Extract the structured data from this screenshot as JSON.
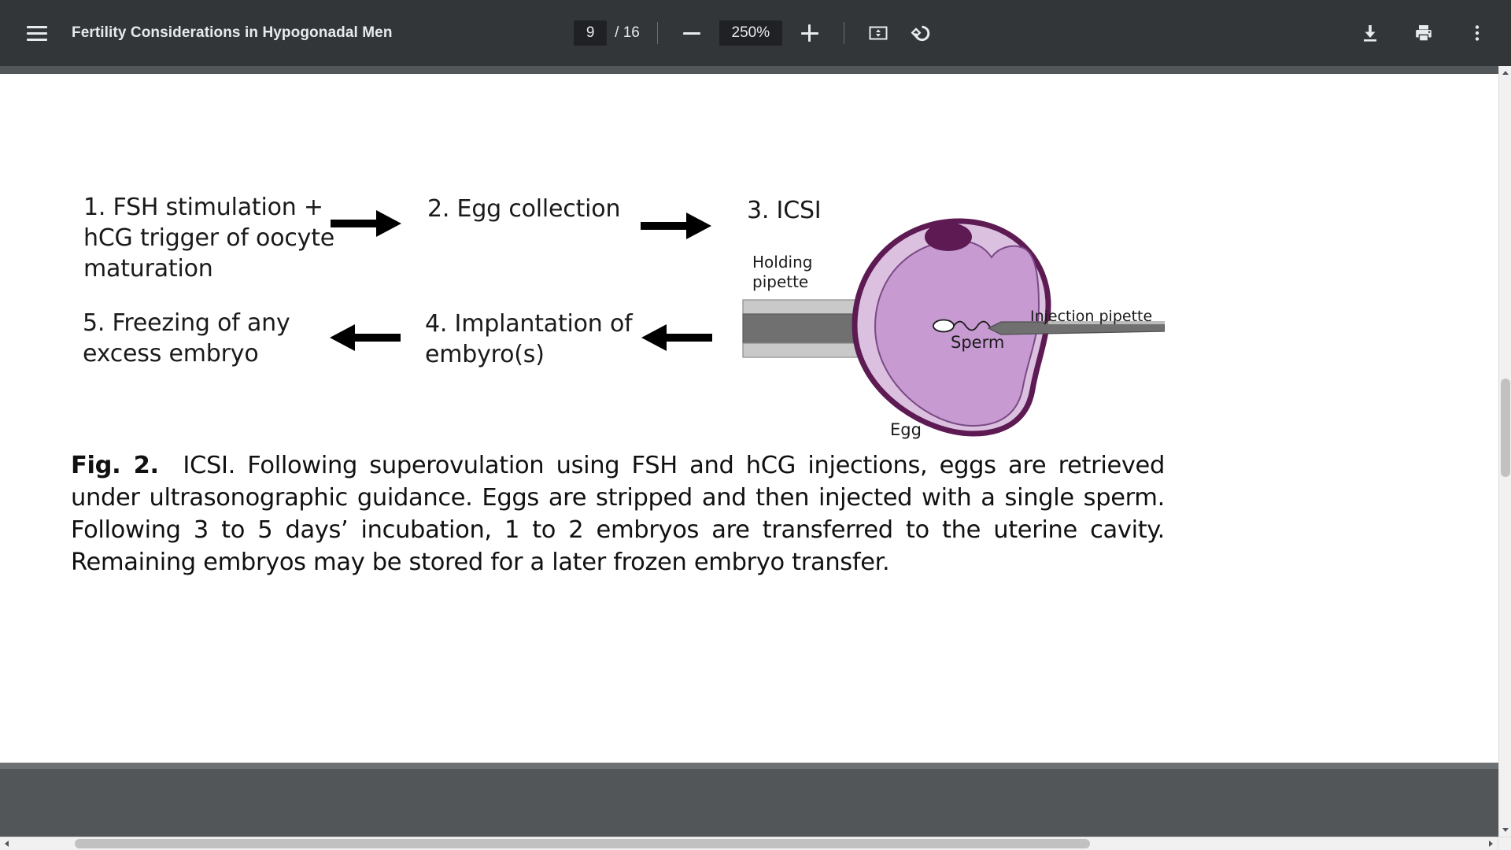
{
  "toolbar": {
    "menu_icon": "hamburger-menu-icon",
    "title": "Fertility Considerations in Hypogonadal Men",
    "page_current": "9",
    "page_total": "/ 16",
    "zoom_out_icon": "minus-icon",
    "zoom_level": "250%",
    "zoom_in_icon": "plus-icon",
    "fit_icon": "fit-to-page-icon",
    "rotate_icon": "rotate-counterclockwise-icon",
    "download_icon": "download-icon",
    "print_icon": "print-icon",
    "more_icon": "more-options-kebab-icon"
  },
  "figure": {
    "steps": [
      {
        "id": "step1",
        "text": "1. FSH stimulation +\nhCG trigger of oocyte\nmaturation"
      },
      {
        "id": "step2",
        "text": "2. Egg collection"
      },
      {
        "id": "step3",
        "text": "3. ICSI"
      },
      {
        "id": "step4",
        "text": "4. Implantation of\nembyro(s)"
      },
      {
        "id": "step5",
        "text": "5. Freezing of any\nexcess embryo"
      }
    ],
    "illustration_labels": {
      "holding_pipette": "Holding\npipette",
      "injection_pipette": "Injection pipette",
      "sperm": "Sperm",
      "egg": "Egg"
    },
    "colors": {
      "zona_outline": "#5d1a53",
      "zona_fill": "#dcc0df",
      "cytoplasm": "#c79bd1",
      "polar_body": "#5d1a53",
      "pipette_outer": "#c9c9c9",
      "pipette_inner": "#707070"
    },
    "caption_label": "Fig. 2.",
    "caption_text": "ICSI. Following superovulation using FSH and hCG injections, eggs are retrieved under ultrasonographic guidance. Eggs are stripped and then injected with a single sperm. Following 3 to 5 days’ incubation, 1 to 2 embryos are transferred to the uterine cavity. Remaining embryos may be stored for a later frozen embryo transfer."
  },
  "scrollbars": {
    "v_up_icon": "triangle-up-icon",
    "v_down_icon": "triangle-down-icon",
    "h_left_icon": "triangle-left-icon",
    "h_right_icon": "triangle-right-icon"
  }
}
